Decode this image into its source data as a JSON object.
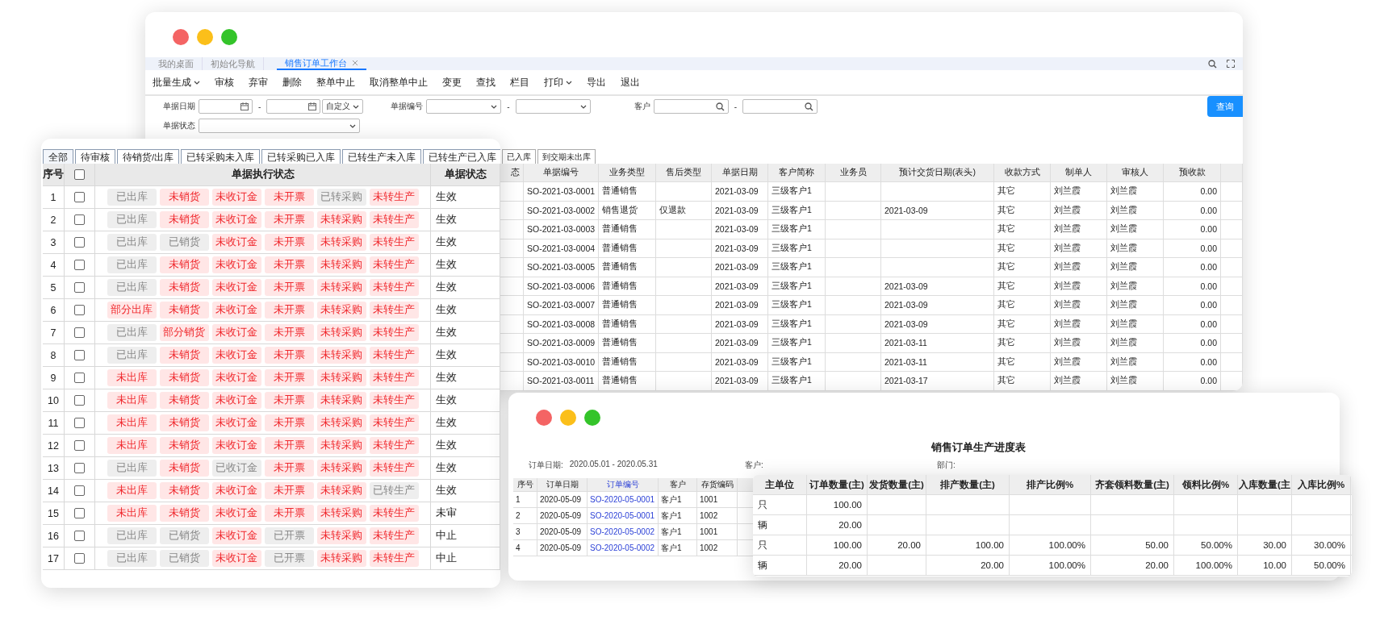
{
  "workbench_window": {
    "tabs": [
      {
        "label": "我的桌面",
        "selected": false,
        "closable": false
      },
      {
        "label": "初始化导航",
        "selected": false,
        "closable": false
      },
      {
        "label": "销售订单工作台",
        "selected": true,
        "closable": true
      }
    ],
    "toolbar": [
      {
        "label": "批量生成",
        "dropdown": true
      },
      {
        "label": "审核",
        "dropdown": false
      },
      {
        "label": "弃审",
        "dropdown": false
      },
      {
        "label": "删除",
        "dropdown": false
      },
      {
        "label": "整单中止",
        "dropdown": false
      },
      {
        "label": "取消整单中止",
        "dropdown": false
      },
      {
        "label": "变更",
        "dropdown": false
      },
      {
        "label": "查找",
        "dropdown": false
      },
      {
        "label": "栏目",
        "dropdown": false
      },
      {
        "label": "打印",
        "dropdown": true
      },
      {
        "label": "导出",
        "dropdown": false
      },
      {
        "label": "退出",
        "dropdown": false
      }
    ],
    "filter_rows": [
      [
        {
          "kind": "date_range",
          "label": "单据日期",
          "separator": "-",
          "mode": "自定义"
        },
        {
          "kind": "select_range",
          "label": "单据编号",
          "separator": "-"
        },
        {
          "kind": "search_range",
          "label": "客户",
          "separator": "-"
        }
      ],
      [
        {
          "kind": "select",
          "label": "单据状态"
        }
      ]
    ],
    "query_button": "查询",
    "status_tabs": [
      {
        "label": "已入库",
        "selected": false
      },
      {
        "label": "到交期未出库",
        "selected": false
      }
    ],
    "table": {
      "columns": [
        {
          "label": "态",
          "kind": "text"
        },
        {
          "label": "单据编号",
          "kind": "text"
        },
        {
          "label": "业务类型",
          "kind": "text"
        },
        {
          "label": "售后类型",
          "kind": "text"
        },
        {
          "label": "单据日期",
          "kind": "text"
        },
        {
          "label": "客户简称",
          "kind": "text"
        },
        {
          "label": "业务员",
          "kind": "text"
        },
        {
          "label": "预计交货日期(表头)",
          "kind": "text"
        },
        {
          "label": "收款方式",
          "kind": "text"
        },
        {
          "label": "制单人",
          "kind": "text"
        },
        {
          "label": "审核人",
          "kind": "text"
        },
        {
          "label": "预收款",
          "kind": "number"
        }
      ],
      "rows": [
        [
          null,
          "SO-2021-03-0001",
          "普通销售",
          null,
          "2021-03-09",
          "三级客户1",
          null,
          null,
          "其它",
          "刘兰霞",
          "刘兰霞",
          "0.00"
        ],
        [
          null,
          "SO-2021-03-0002",
          "销售退货",
          "仅退款",
          "2021-03-09",
          "三级客户1",
          null,
          "2021-03-09",
          "其它",
          "刘兰霞",
          "刘兰霞",
          "0.00"
        ],
        [
          null,
          "SO-2021-03-0003",
          "普通销售",
          null,
          "2021-03-09",
          "三级客户1",
          null,
          null,
          "其它",
          "刘兰霞",
          "刘兰霞",
          "0.00"
        ],
        [
          null,
          "SO-2021-03-0004",
          "普通销售",
          null,
          "2021-03-09",
          "三级客户1",
          null,
          null,
          "其它",
          "刘兰霞",
          "刘兰霞",
          "0.00"
        ],
        [
          null,
          "SO-2021-03-0005",
          "普通销售",
          null,
          "2021-03-09",
          "三级客户1",
          null,
          null,
          "其它",
          "刘兰霞",
          "刘兰霞",
          "0.00"
        ],
        [
          null,
          "SO-2021-03-0006",
          "普通销售",
          null,
          "2021-03-09",
          "三级客户1",
          null,
          "2021-03-09",
          "其它",
          "刘兰霞",
          "刘兰霞",
          "0.00"
        ],
        [
          null,
          "SO-2021-03-0007",
          "普通销售",
          null,
          "2021-03-09",
          "三级客户1",
          null,
          "2021-03-09",
          "其它",
          "刘兰霞",
          "刘兰霞",
          "0.00"
        ],
        [
          null,
          "SO-2021-03-0008",
          "普通销售",
          null,
          "2021-03-09",
          "三级客户1",
          null,
          "2021-03-09",
          "其它",
          "刘兰霞",
          "刘兰霞",
          "0.00"
        ],
        [
          null,
          "SO-2021-03-0009",
          "普通销售",
          null,
          "2021-03-09",
          "三级客户1",
          null,
          "2021-03-11",
          "其它",
          "刘兰霞",
          "刘兰霞",
          "0.00"
        ],
        [
          null,
          "SO-2021-03-0010",
          "普通销售",
          null,
          "2021-03-09",
          "三级客户1",
          null,
          "2021-03-11",
          "其它",
          "刘兰霞",
          "刘兰霞",
          "0.00"
        ],
        [
          null,
          "SO-2021-03-0011",
          "普通销售",
          null,
          "2021-03-09",
          "三级客户1",
          null,
          "2021-03-17",
          "其它",
          "刘兰霞",
          "刘兰霞",
          "0.00"
        ]
      ]
    }
  },
  "status_window": {
    "tabs": [
      {
        "label": "全部",
        "selected": true
      },
      {
        "label": "待审核",
        "selected": false
      },
      {
        "label": "待销货/出库",
        "selected": false
      },
      {
        "label": "已转采购未入库",
        "selected": false
      },
      {
        "label": "已转采购已入库",
        "selected": false
      },
      {
        "label": "已转生产未入库",
        "selected": false
      },
      {
        "label": "已转生产已入库",
        "selected": false
      }
    ],
    "columns": {
      "number": "序号",
      "statuses": "单据执行状态",
      "state": "单据状态"
    },
    "select_all": false,
    "rows": [
      {
        "no": "1",
        "checked": false,
        "state": "生效",
        "statuses": [
          {
            "label": "已出库",
            "kind": "done"
          },
          {
            "label": "未销货",
            "kind": "pending"
          },
          {
            "label": "未收订金",
            "kind": "pending"
          },
          {
            "label": "未开票",
            "kind": "pending"
          },
          {
            "label": "已转采购",
            "kind": "done"
          },
          {
            "label": "未转生产",
            "kind": "pending"
          }
        ]
      },
      {
        "no": "2",
        "checked": false,
        "state": "生效",
        "statuses": [
          {
            "label": "已出库",
            "kind": "done"
          },
          {
            "label": "未销货",
            "kind": "pending"
          },
          {
            "label": "未收订金",
            "kind": "pending"
          },
          {
            "label": "未开票",
            "kind": "pending"
          },
          {
            "label": "未转采购",
            "kind": "pending"
          },
          {
            "label": "未转生产",
            "kind": "pending"
          }
        ]
      },
      {
        "no": "3",
        "checked": false,
        "state": "生效",
        "statuses": [
          {
            "label": "已出库",
            "kind": "done"
          },
          {
            "label": "已销货",
            "kind": "done"
          },
          {
            "label": "未收订金",
            "kind": "pending"
          },
          {
            "label": "未开票",
            "kind": "pending"
          },
          {
            "label": "未转采购",
            "kind": "pending"
          },
          {
            "label": "未转生产",
            "kind": "pending"
          }
        ]
      },
      {
        "no": "4",
        "checked": false,
        "state": "生效",
        "statuses": [
          {
            "label": "已出库",
            "kind": "done"
          },
          {
            "label": "未销货",
            "kind": "pending"
          },
          {
            "label": "未收订金",
            "kind": "pending"
          },
          {
            "label": "未开票",
            "kind": "pending"
          },
          {
            "label": "未转采购",
            "kind": "pending"
          },
          {
            "label": "未转生产",
            "kind": "pending"
          }
        ]
      },
      {
        "no": "5",
        "checked": false,
        "state": "生效",
        "statuses": [
          {
            "label": "已出库",
            "kind": "done"
          },
          {
            "label": "未销货",
            "kind": "pending"
          },
          {
            "label": "未收订金",
            "kind": "pending"
          },
          {
            "label": "未开票",
            "kind": "pending"
          },
          {
            "label": "未转采购",
            "kind": "pending"
          },
          {
            "label": "未转生产",
            "kind": "pending"
          }
        ]
      },
      {
        "no": "6",
        "checked": false,
        "state": "生效",
        "statuses": [
          {
            "label": "部分出库",
            "kind": "pending"
          },
          {
            "label": "未销货",
            "kind": "pending"
          },
          {
            "label": "未收订金",
            "kind": "pending"
          },
          {
            "label": "未开票",
            "kind": "pending"
          },
          {
            "label": "未转采购",
            "kind": "pending"
          },
          {
            "label": "未转生产",
            "kind": "pending"
          }
        ]
      },
      {
        "no": "7",
        "checked": false,
        "state": "生效",
        "statuses": [
          {
            "label": "已出库",
            "kind": "done"
          },
          {
            "label": "部分销货",
            "kind": "pending"
          },
          {
            "label": "未收订金",
            "kind": "pending"
          },
          {
            "label": "未开票",
            "kind": "pending"
          },
          {
            "label": "未转采购",
            "kind": "pending"
          },
          {
            "label": "未转生产",
            "kind": "pending"
          }
        ]
      },
      {
        "no": "8",
        "checked": false,
        "state": "生效",
        "statuses": [
          {
            "label": "已出库",
            "kind": "done"
          },
          {
            "label": "未销货",
            "kind": "pending"
          },
          {
            "label": "未收订金",
            "kind": "pending"
          },
          {
            "label": "未开票",
            "kind": "pending"
          },
          {
            "label": "未转采购",
            "kind": "pending"
          },
          {
            "label": "未转生产",
            "kind": "pending"
          }
        ]
      },
      {
        "no": "9",
        "checked": false,
        "state": "生效",
        "statuses": [
          {
            "label": "未出库",
            "kind": "pending"
          },
          {
            "label": "未销货",
            "kind": "pending"
          },
          {
            "label": "未收订金",
            "kind": "pending"
          },
          {
            "label": "未开票",
            "kind": "pending"
          },
          {
            "label": "未转采购",
            "kind": "pending"
          },
          {
            "label": "未转生产",
            "kind": "pending"
          }
        ]
      },
      {
        "no": "10",
        "checked": false,
        "state": "生效",
        "statuses": [
          {
            "label": "未出库",
            "kind": "pending"
          },
          {
            "label": "未销货",
            "kind": "pending"
          },
          {
            "label": "未收订金",
            "kind": "pending"
          },
          {
            "label": "未开票",
            "kind": "pending"
          },
          {
            "label": "未转采购",
            "kind": "pending"
          },
          {
            "label": "未转生产",
            "kind": "pending"
          }
        ]
      },
      {
        "no": "11",
        "checked": false,
        "state": "生效",
        "statuses": [
          {
            "label": "未出库",
            "kind": "pending"
          },
          {
            "label": "未销货",
            "kind": "pending"
          },
          {
            "label": "未收订金",
            "kind": "pending"
          },
          {
            "label": "未开票",
            "kind": "pending"
          },
          {
            "label": "未转采购",
            "kind": "pending"
          },
          {
            "label": "未转生产",
            "kind": "pending"
          }
        ]
      },
      {
        "no": "12",
        "checked": false,
        "state": "生效",
        "statuses": [
          {
            "label": "未出库",
            "kind": "pending"
          },
          {
            "label": "未销货",
            "kind": "pending"
          },
          {
            "label": "未收订金",
            "kind": "pending"
          },
          {
            "label": "未开票",
            "kind": "pending"
          },
          {
            "label": "未转采购",
            "kind": "pending"
          },
          {
            "label": "未转生产",
            "kind": "pending"
          }
        ]
      },
      {
        "no": "13",
        "checked": false,
        "state": "生效",
        "statuses": [
          {
            "label": "已出库",
            "kind": "done"
          },
          {
            "label": "未销货",
            "kind": "pending"
          },
          {
            "label": "已收订金",
            "kind": "done"
          },
          {
            "label": "未开票",
            "kind": "pending"
          },
          {
            "label": "未转采购",
            "kind": "pending"
          },
          {
            "label": "未转生产",
            "kind": "pending"
          }
        ]
      },
      {
        "no": "14",
        "checked": false,
        "state": "生效",
        "statuses": [
          {
            "label": "未出库",
            "kind": "pending"
          },
          {
            "label": "未销货",
            "kind": "pending"
          },
          {
            "label": "未收订金",
            "kind": "pending"
          },
          {
            "label": "未开票",
            "kind": "pending"
          },
          {
            "label": "未转采购",
            "kind": "pending"
          },
          {
            "label": "已转生产",
            "kind": "done"
          }
        ]
      },
      {
        "no": "15",
        "checked": false,
        "state": "未审",
        "statuses": [
          {
            "label": "未出库",
            "kind": "pending"
          },
          {
            "label": "未销货",
            "kind": "pending"
          },
          {
            "label": "未收订金",
            "kind": "pending"
          },
          {
            "label": "未开票",
            "kind": "pending"
          },
          {
            "label": "未转采购",
            "kind": "pending"
          },
          {
            "label": "未转生产",
            "kind": "pending"
          }
        ]
      },
      {
        "no": "16",
        "checked": false,
        "state": "中止",
        "statuses": [
          {
            "label": "已出库",
            "kind": "done"
          },
          {
            "label": "已销货",
            "kind": "done"
          },
          {
            "label": "未收订金",
            "kind": "pending"
          },
          {
            "label": "已开票",
            "kind": "done"
          },
          {
            "label": "未转采购",
            "kind": "pending"
          },
          {
            "label": "未转生产",
            "kind": "pending"
          }
        ]
      },
      {
        "no": "17",
        "checked": false,
        "state": "中止",
        "statuses": [
          {
            "label": "已出库",
            "kind": "done"
          },
          {
            "label": "已销货",
            "kind": "done"
          },
          {
            "label": "未收订金",
            "kind": "pending"
          },
          {
            "label": "已开票",
            "kind": "done"
          },
          {
            "label": "未转采购",
            "kind": "pending"
          },
          {
            "label": "未转生产",
            "kind": "pending"
          }
        ]
      }
    ]
  },
  "report_window": {
    "title": "销售订单生产进度表",
    "info": [
      {
        "label": "订单日期:",
        "value": "2020.05.01 - 2020.05.31"
      },
      {
        "label": "客户:"
      },
      {
        "label": "部门:"
      }
    ],
    "table": {
      "columns": [
        {
          "label": "序号",
          "kind": "text"
        },
        {
          "label": "订单日期",
          "kind": "text"
        },
        {
          "label": "订单编号",
          "kind": "link"
        },
        {
          "label": "客户",
          "kind": "text"
        },
        {
          "label": "存货编码",
          "kind": "text"
        }
      ],
      "rows": [
        [
          "1",
          "2020-05-09",
          "SO-2020-05-0001",
          "客户1",
          "1001"
        ],
        [
          "2",
          "2020-05-09",
          "SO-2020-05-0001",
          "客户1",
          "1002"
        ],
        [
          "3",
          "2020-05-09",
          "SO-2020-05-0002",
          "客户1",
          "1001"
        ],
        [
          "4",
          "2020-05-09",
          "SO-2020-05-0002",
          "客户1",
          "1002"
        ]
      ]
    }
  },
  "progress_panel": {
    "columns": [
      {
        "label": "主单位",
        "kind": "text"
      },
      {
        "label": "订单数量(主)",
        "kind": "number"
      },
      {
        "label": "发货数量(主)",
        "kind": "number"
      },
      {
        "label": "排产数量(主)",
        "kind": "number"
      },
      {
        "label": "排产比例%",
        "kind": "number"
      },
      {
        "label": "齐套领料数量(主)",
        "kind": "number"
      },
      {
        "label": "领料比例%",
        "kind": "number"
      },
      {
        "label": "入库数量(主",
        "kind": "number"
      },
      {
        "label": "入库比例%",
        "kind": "number"
      }
    ],
    "rows": [
      [
        "只",
        "100.00",
        null,
        null,
        null,
        null,
        null,
        null,
        null
      ],
      [
        "辆",
        "20.00",
        null,
        null,
        null,
        null,
        null,
        null,
        null
      ],
      [
        "只",
        "100.00",
        "20.00",
        "100.00",
        "100.00%",
        "50.00",
        "50.00%",
        "30.00",
        "30.00%"
      ],
      [
        "辆",
        "20.00",
        null,
        "20.00",
        "100.00%",
        "20.00",
        "100.00%",
        "10.00",
        "50.00%"
      ]
    ]
  }
}
